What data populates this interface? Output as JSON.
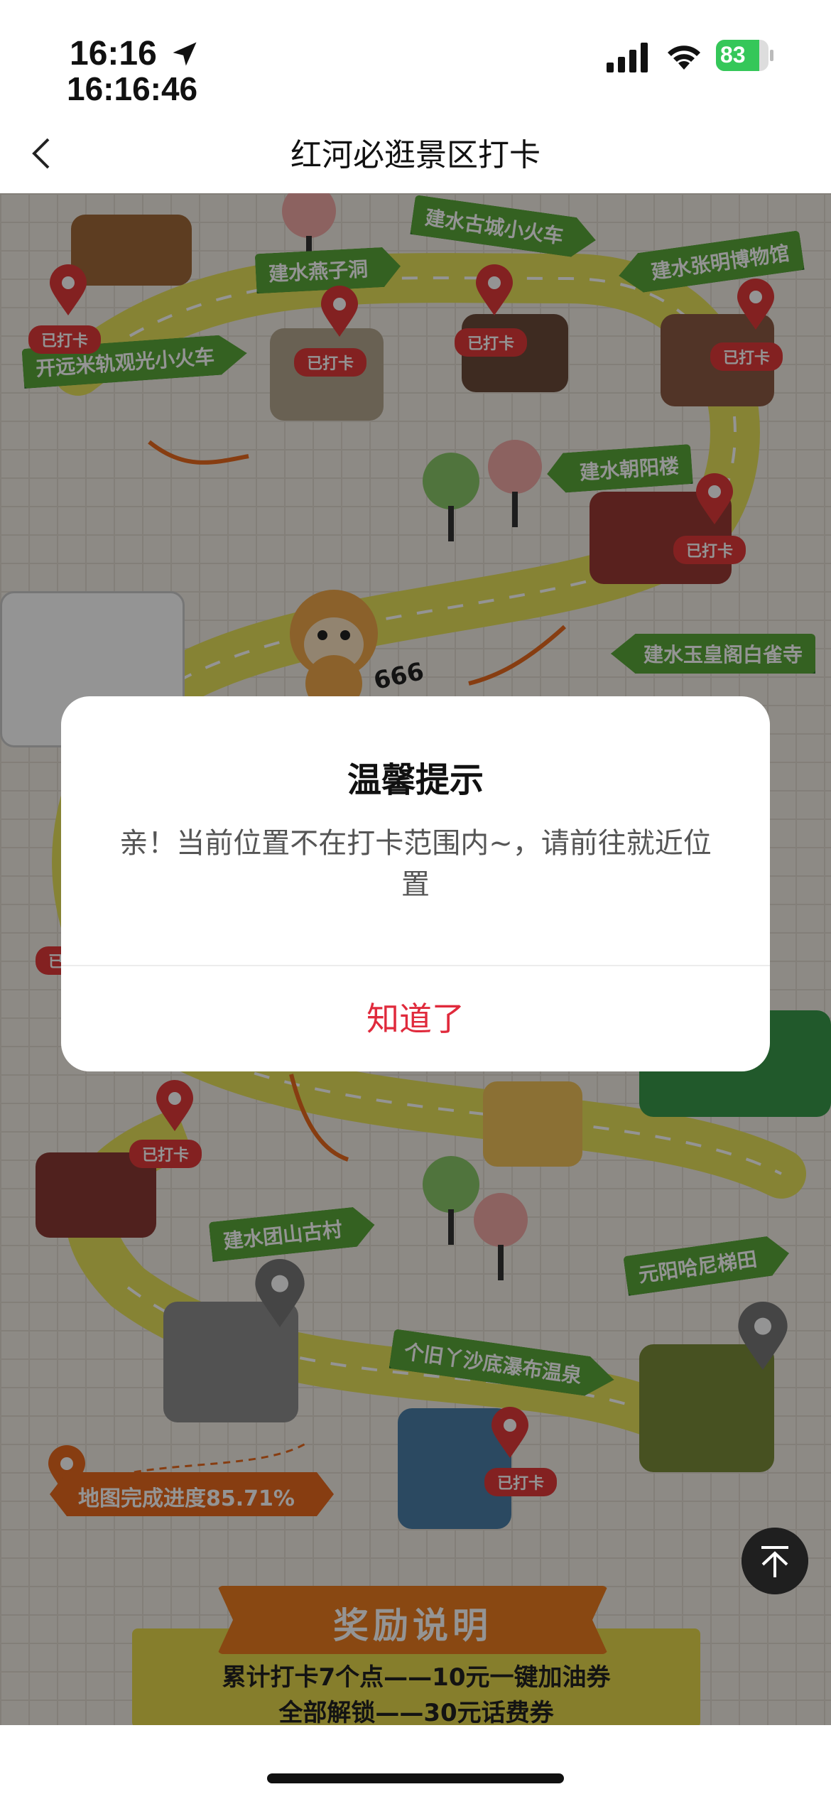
{
  "status_bar": {
    "time": "16:16",
    "time_seconds": "16:16:46",
    "battery_percent": "83",
    "battery_level": 0.83
  },
  "nav": {
    "title": "红河必逛景区打卡",
    "back_icon": "chevron-left-icon"
  },
  "map": {
    "spots": [
      {
        "name": "开远米轨观光小火车",
        "tag": "已打卡"
      },
      {
        "name": "建水燕子洞",
        "tag": "已打卡"
      },
      {
        "name": "建水古城小火车",
        "tag": "已打卡"
      },
      {
        "name": "建水张明博物馆",
        "tag": "已打卡"
      },
      {
        "name": "建水朝阳楼",
        "tag": "已打卡"
      },
      {
        "name": "建水玉皇阁白雀寺",
        "tag": ""
      },
      {
        "name": "建水团山古村",
        "tag": ""
      },
      {
        "name": "个旧丫沙底瀑布温泉",
        "tag": "已打卡"
      },
      {
        "name": "元阳哈尼梯田",
        "tag": ""
      }
    ],
    "extra_tags": [
      "已打卡",
      "已打卡"
    ],
    "mascot_text": "666",
    "progress_text": "地图完成进度85.71%",
    "reward": {
      "title": "奖励说明",
      "line1": "累计打卡7个点——10元一键加油券",
      "line2": "全部解锁——30元话费券"
    }
  },
  "dialog": {
    "title": "温馨提示",
    "message": "亲！当前位置不在打卡范围内~，请前往就近位置",
    "confirm": "知道了"
  },
  "scroll_top_icon": "arrow-up-to-top-icon"
}
